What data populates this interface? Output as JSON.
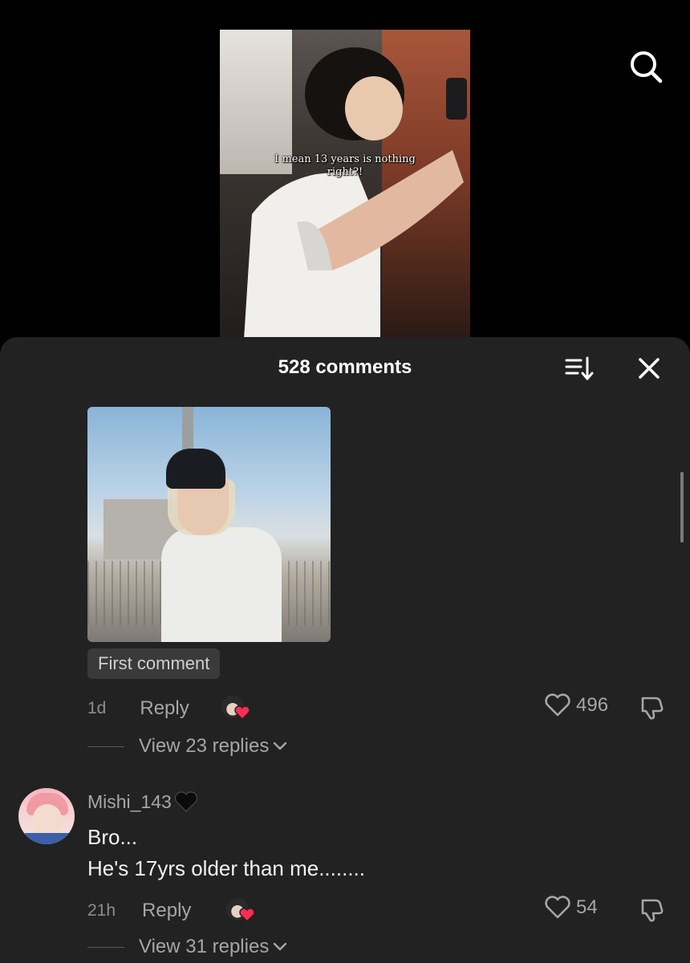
{
  "video": {
    "caption": "I mean 13 years is nothing right?!"
  },
  "header": {
    "search_icon": "search-icon"
  },
  "sheet": {
    "title": "528 comments",
    "sort_icon": "sort-icon",
    "close_icon": "close-icon"
  },
  "comments": [
    {
      "badge": "First comment",
      "time": "1d",
      "reply_label": "Reply",
      "likes": "496",
      "view_replies": "View 23 replies"
    },
    {
      "username": "Mishi_143",
      "username_emoji": "black-heart-icon",
      "text_line1": "Bro...",
      "text_line2": "He's 17yrs older than me........",
      "time": "21h",
      "reply_label": "Reply",
      "likes": "54",
      "view_replies": "View 31 replies"
    }
  ],
  "colors": {
    "sheet_bg": "#222223",
    "text_muted": "#a6a6a7",
    "heart_red": "#fe2c55"
  }
}
